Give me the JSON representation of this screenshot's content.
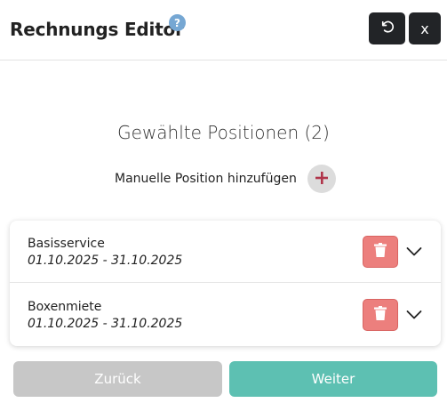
{
  "header": {
    "title": "Rechnungs Editor",
    "help_label": "?",
    "close_label": "x"
  },
  "main": {
    "section_title": "Gewählte Positionen (2)",
    "manual_label": "Manuelle Position hinzufügen"
  },
  "items": [
    {
      "name": "Basisservice",
      "date": "01.10.2025 - 31.10.2025"
    },
    {
      "name": "Boxenmiete",
      "date": "01.10.2025 - 31.10.2025"
    }
  ],
  "footer": {
    "back_label": "Zurück",
    "next_label": "Weiter"
  },
  "colors": {
    "delete": "#ec7f7d",
    "next": "#5dc0b2",
    "back": "#c7c7c7",
    "header_button": "#222427",
    "add_plus": "#b0344a",
    "help": "#76a7d3"
  },
  "icons": [
    "help-icon",
    "reset-icon",
    "plus-icon",
    "trash-icon",
    "chevron-down-icon"
  ]
}
